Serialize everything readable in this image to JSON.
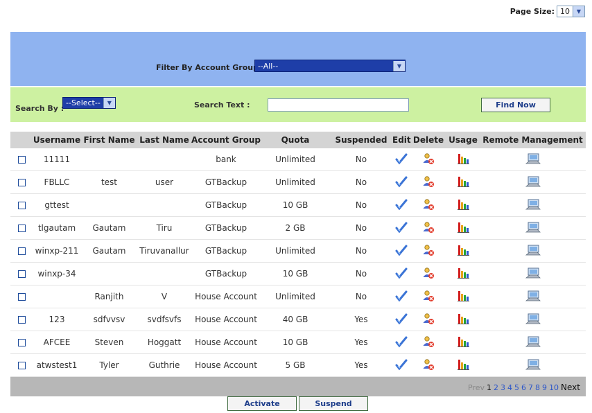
{
  "page_size": {
    "label": "Page Size:",
    "value": "10"
  },
  "filter": {
    "label": "Filter By Account Group :",
    "value": "--All--"
  },
  "search": {
    "by_label": "Search By :",
    "by_value": "--Select--",
    "text_label": "Search Text :",
    "text_value": "",
    "find_label": "Find Now"
  },
  "table": {
    "columns": [
      "",
      "Username",
      "First Name",
      "Last Name",
      "Account Group",
      "Quota",
      "Suspended",
      "Edit",
      "Delete",
      "Usage",
      "Remote Management"
    ],
    "rows": [
      {
        "username": "11111",
        "first": "",
        "last": "",
        "group": "bank",
        "quota": "Unlimited",
        "suspended": "No"
      },
      {
        "username": "FBLLC",
        "first": "test",
        "last": "user",
        "group": "GTBackup",
        "quota": "Unlimited",
        "suspended": "No"
      },
      {
        "username": "gttest",
        "first": "",
        "last": "",
        "group": "GTBackup",
        "quota": "10 GB",
        "suspended": "No"
      },
      {
        "username": "tlgautam",
        "first": "Gautam",
        "last": "Tiru",
        "group": "GTBackup",
        "quota": "2 GB",
        "suspended": "No"
      },
      {
        "username": "winxp-211",
        "first": "Gautam",
        "last": "Tiruvanallur",
        "group": "GTBackup",
        "quota": "Unlimited",
        "suspended": "No"
      },
      {
        "username": "winxp-34",
        "first": "",
        "last": "",
        "group": "GTBackup",
        "quota": "10 GB",
        "suspended": "No"
      },
      {
        "username": "",
        "first": "Ranjith",
        "last": "V",
        "group": "House Account",
        "quota": "Unlimited",
        "suspended": "No"
      },
      {
        "username": "123",
        "first": "sdfvvsv",
        "last": "svdfsvfs",
        "group": "House Account",
        "quota": "40 GB",
        "suspended": "Yes"
      },
      {
        "username": "AFCEE",
        "first": "Steven",
        "last": "Hoggatt",
        "group": "House Account",
        "quota": "10 GB",
        "suspended": "Yes"
      },
      {
        "username": "atwstest1",
        "first": "Tyler",
        "last": "Guthrie",
        "group": "House Account",
        "quota": "5 GB",
        "suspended": "Yes"
      }
    ]
  },
  "pager": {
    "prev": "Prev",
    "current": "1",
    "pages": [
      "2",
      "3",
      "4",
      "5",
      "6",
      "7",
      "8",
      "9",
      "10"
    ],
    "next": "Next"
  },
  "actions": {
    "activate": "Activate",
    "suspend": "Suspend"
  },
  "icons": {
    "edit": "edit-check-icon",
    "delete": "delete-user-icon",
    "usage": "usage-chart-icon",
    "remote": "remote-management-icon"
  }
}
